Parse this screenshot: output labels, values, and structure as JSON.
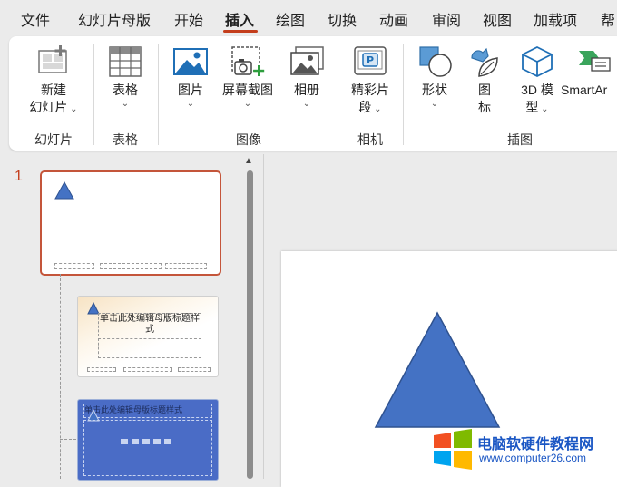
{
  "menu": {
    "tabs": [
      {
        "label": "文件"
      },
      {
        "label": "幻灯片母版"
      },
      {
        "label": "开始"
      },
      {
        "label": "插入"
      },
      {
        "label": "绘图"
      },
      {
        "label": "切换"
      },
      {
        "label": "动画"
      },
      {
        "label": "审阅"
      },
      {
        "label": "视图"
      },
      {
        "label": "加载项"
      },
      {
        "label": "帮"
      }
    ],
    "active": "插入"
  },
  "ribbon": {
    "new_slide": {
      "line1": "新建",
      "line2": "幻灯片"
    },
    "table": {
      "label": "表格"
    },
    "picture": {
      "label": "图片"
    },
    "screenshot": {
      "label": "屏幕截图"
    },
    "album": {
      "label": "相册"
    },
    "clip": {
      "line1": "精彩片",
      "line2": "段"
    },
    "shapes": {
      "label": "形状"
    },
    "icons": {
      "line1": "图",
      "line2": "标"
    },
    "models3d": {
      "line1": "3D 模",
      "line2": "型"
    },
    "smartart": {
      "label": "SmartAr"
    },
    "groups": {
      "slides": "幻灯片",
      "tables": "表格",
      "images": "图像",
      "camera": "相机",
      "illustrations": "插图"
    }
  },
  "slide_panel": {
    "number": "1",
    "thumb2_title": "单击此处编辑母版标题样式",
    "thumb3_title": "单击此处编辑母版标题样式"
  },
  "colors": {
    "accent": "#c43e1c",
    "shape_fill": "#4472c4",
    "shape_stroke": "#2f528f"
  },
  "watermark": {
    "title": "电脑软硬件教程网",
    "url": "www.computer26.com"
  }
}
